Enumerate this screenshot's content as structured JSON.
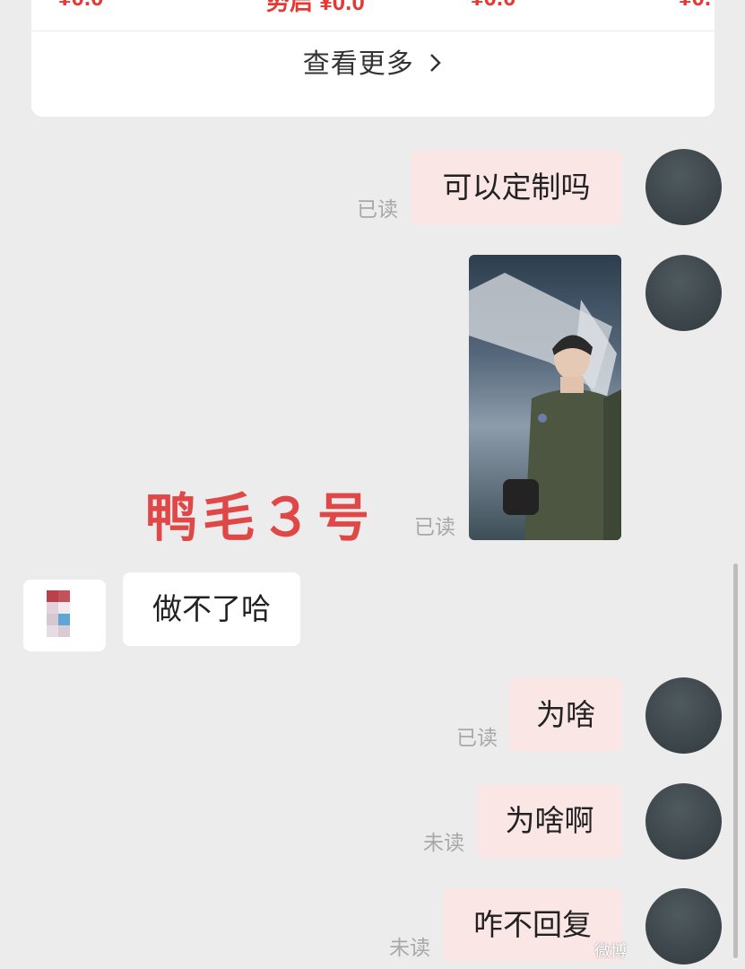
{
  "product_card": {
    "prices": [
      "¥0.0",
      "势启 ¥0.0",
      "¥0.0",
      "¥0."
    ],
    "see_more": "查看更多"
  },
  "messages": [
    {
      "text": "可以定制吗",
      "status": "已读",
      "side": "out"
    },
    {
      "type": "image",
      "status": "已读",
      "side": "out"
    },
    {
      "text": "做不了哈",
      "side": "in"
    },
    {
      "text": "为啥",
      "status": "已读",
      "side": "out"
    },
    {
      "text": "为啥啊",
      "status": "未读",
      "side": "out"
    },
    {
      "text": "咋不回复",
      "status": "未读",
      "side": "out"
    }
  ],
  "overlay_title": "鸭毛３号",
  "watermark": "微博",
  "colors": {
    "background": "#ececec",
    "outgoing_bubble": "#fbe6e6",
    "incoming_bubble": "#ffffff",
    "price_red": "#e53935",
    "overlay_red": "#e04848",
    "status_gray": "#a8a8a8"
  }
}
